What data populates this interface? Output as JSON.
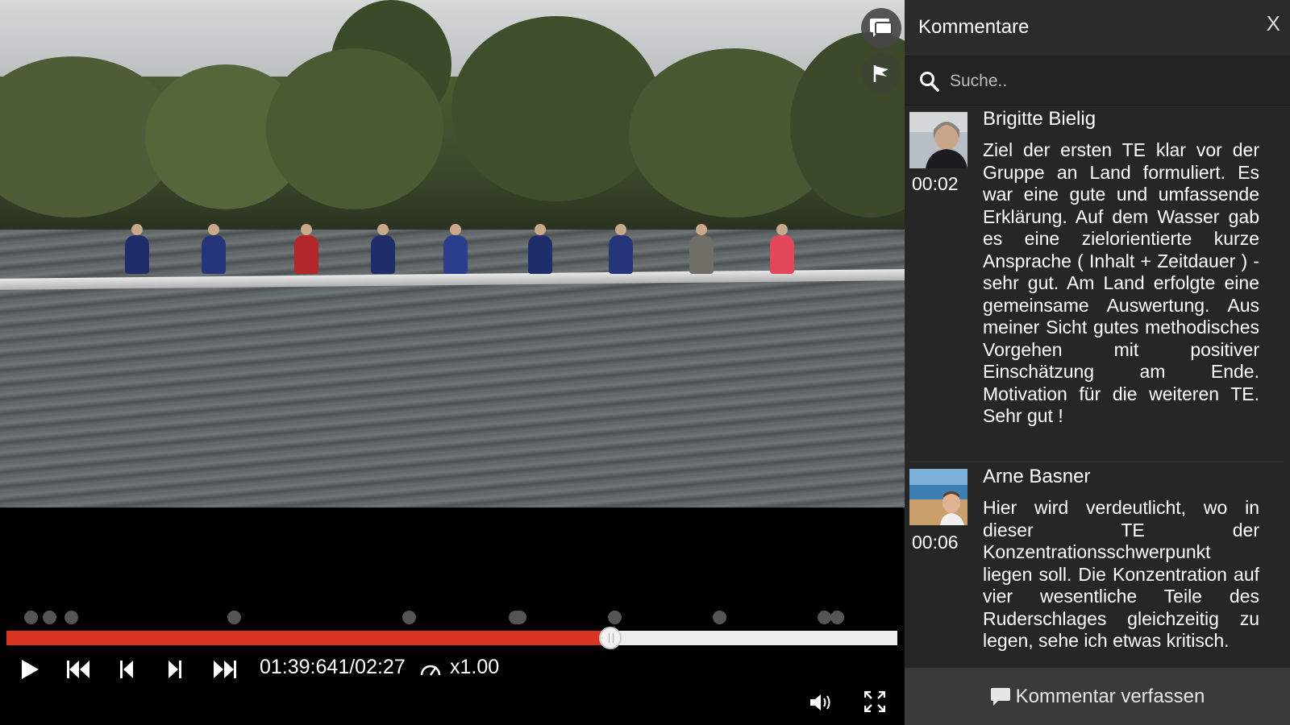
{
  "player": {
    "time_display": "01:39:641/02:27",
    "speed_label": "x1.00",
    "progress_fraction": 0.678,
    "marker_positions_fraction": [
      0.027,
      0.048,
      0.072,
      0.255,
      0.452,
      0.571,
      0.576,
      0.682,
      0.8,
      0.918,
      0.932
    ]
  },
  "sidebar": {
    "title": "Kommentare",
    "close_label": "X",
    "search_placeholder": "Suche..",
    "footer_label": "Kommentar verfassen",
    "comments": [
      {
        "author": "Brigitte Bielig",
        "time": "00:02",
        "text": "Ziel der ersten TE klar vor der Gruppe an Land formuliert. Es war eine gute und umfassende Erklärung. Auf dem Wasser gab es eine zielorientierte kurze Ansprache ( Inhalt + Zeitdauer ) - sehr gut. Am Land erfolgte eine gemeinsame Auswertung. Aus meiner Sicht gutes methodisches Vorgehen mit positiver Einschätzung am Ende. Motivation für die weiteren TE. Sehr gut !"
      },
      {
        "author": "Arne Basner",
        "time": "00:06",
        "text": "Hier wird verdeutlicht, wo in dieser TE der Konzentrationsschwerpunkt liegen soll. Die Konzentration auf vier wesentliche Teile des Ruderschlages gleichzeitig zu legen, sehe ich etwas kritisch."
      }
    ]
  },
  "colors": {
    "accent": "#d9341f",
    "sidebar_bg": "#262626",
    "footer_bg": "#3a3a3a"
  },
  "icons": [
    "chat-icon",
    "flag-icon",
    "play-icon",
    "skip-to-start-icon",
    "step-back-icon",
    "step-forward-icon",
    "skip-to-end-icon",
    "speedometer-icon",
    "volume-icon",
    "fullscreen-icon",
    "search-icon",
    "comment-icon"
  ]
}
